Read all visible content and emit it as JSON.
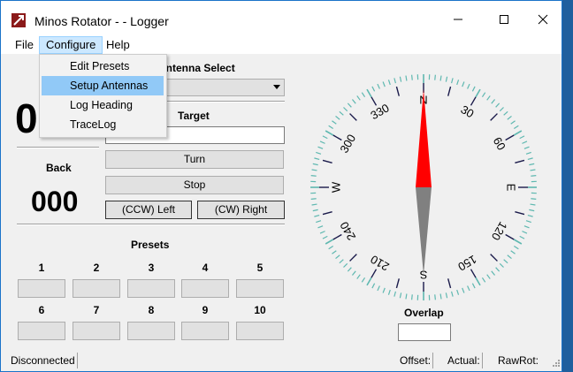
{
  "window": {
    "title": "Minos Rotator - - Logger"
  },
  "menubar": {
    "file": "File",
    "configure": "Configure",
    "help": "Help"
  },
  "configure_menu": {
    "items": [
      {
        "label": "Edit Presets"
      },
      {
        "label": "Setup Antennas"
      },
      {
        "label": "Log Heading"
      },
      {
        "label": "TraceLog"
      }
    ]
  },
  "heading": {
    "current_value": "0",
    "back_label": "Back",
    "back_value": "000"
  },
  "antenna": {
    "label": "Antenna Select",
    "selected": ""
  },
  "target": {
    "label": "Target",
    "value": ""
  },
  "controls": {
    "turn": "Turn",
    "stop": "Stop",
    "ccw": "(CCW) Left",
    "cw": "(CW) Right"
  },
  "presets": {
    "label": "Presets",
    "numbers": [
      "1",
      "2",
      "3",
      "4",
      "5",
      "6",
      "7",
      "8",
      "9",
      "10"
    ]
  },
  "compass": {
    "labels": [
      "N",
      "30",
      "60",
      "E",
      "120",
      "150",
      "S",
      "210",
      "240",
      "W",
      "300",
      "330"
    ],
    "needle_north_color": "#ff0000",
    "needle_south_color": "#808080",
    "tick_color": "#5fb8b0"
  },
  "overlap": {
    "label": "Overlap",
    "value": ""
  },
  "status": {
    "connection": "Disconnected",
    "offset": "Offset:",
    "actual": "Actual:",
    "rawrot": "RawRot:"
  }
}
